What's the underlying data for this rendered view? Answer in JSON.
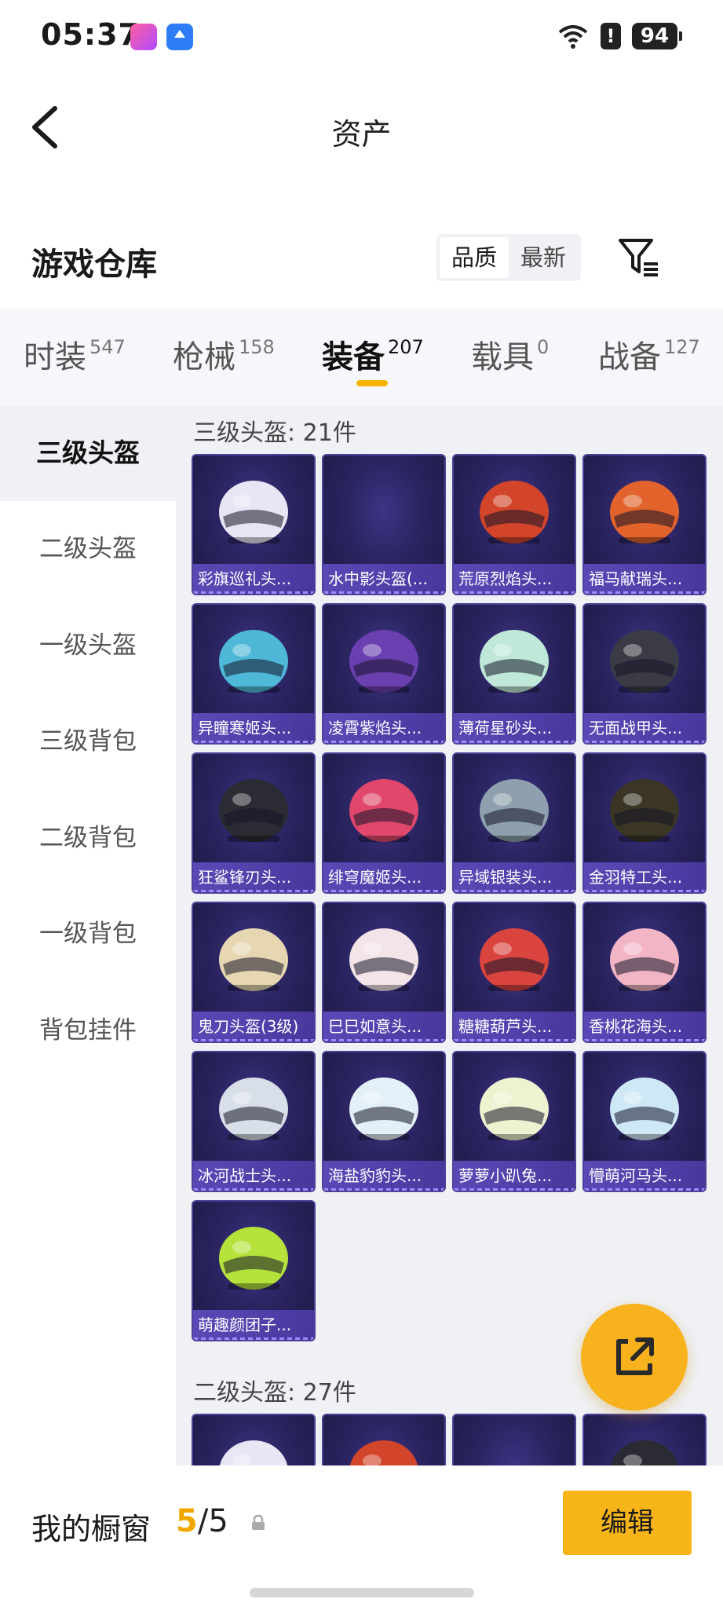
{
  "status_bar": {
    "time": "05:37",
    "battery": "94",
    "alert": "!"
  },
  "header": {
    "title": "资产"
  },
  "warehouse": {
    "title": "游戏仓库",
    "sort_options": [
      {
        "label": "品质",
        "active": true
      },
      {
        "label": "最新",
        "active": false
      }
    ]
  },
  "category_tabs": [
    {
      "label": "时装",
      "count": "547",
      "active": false
    },
    {
      "label": "枪械",
      "count": "158",
      "active": false
    },
    {
      "label": "装备",
      "count": "207",
      "active": true
    },
    {
      "label": "载具",
      "count": "0",
      "active": false
    },
    {
      "label": "战备",
      "count": "127",
      "active": false
    }
  ],
  "side_nav": [
    {
      "label": "三级头盔",
      "active": true
    },
    {
      "label": "二级头盔",
      "active": false
    },
    {
      "label": "一级头盔",
      "active": false
    },
    {
      "label": "三级背包",
      "active": false
    },
    {
      "label": "二级背包",
      "active": false
    },
    {
      "label": "一级背包",
      "active": false
    },
    {
      "label": "背包挂件",
      "active": false
    }
  ],
  "groups": [
    {
      "title": "三级头盔: 21件",
      "items": [
        {
          "name": "彩旗巡礼头...",
          "color": "#e8e6f4"
        },
        {
          "name": "水中影头盔(...",
          "color": ""
        },
        {
          "name": "荒原烈焰头...",
          "color": "#d2452a"
        },
        {
          "name": "福马献瑞头...",
          "color": "#e2632b"
        },
        {
          "name": "异瞳寒姬头...",
          "color": "#4fb8d8"
        },
        {
          "name": "凌霄紫焰头...",
          "color": "#6a3fb0"
        },
        {
          "name": "薄荷星砂头...",
          "color": "#bfe8d8"
        },
        {
          "name": "无面战甲头...",
          "color": "#3b3b46"
        },
        {
          "name": "狂鲨锋刃头...",
          "color": "#2b2b33"
        },
        {
          "name": "绯穹魔姬头...",
          "color": "#e0476b"
        },
        {
          "name": "异域银装头...",
          "color": "#8ea0ad"
        },
        {
          "name": "金羽特工头...",
          "color": "#3a3524"
        },
        {
          "name": "鬼刀头盔(3级)",
          "color": "#e6d7b2"
        },
        {
          "name": "巳巳如意头...",
          "color": "#f3e4e8"
        },
        {
          "name": "糖糖葫芦头...",
          "color": "#d9443e"
        },
        {
          "name": "香桃花海头...",
          "color": "#f2b5c6"
        },
        {
          "name": "冰河战士头...",
          "color": "#d8dfe8"
        },
        {
          "name": "海盐豹豹头...",
          "color": "#e4f0f8"
        },
        {
          "name": "萝萝小趴兔...",
          "color": "#eef2d0"
        },
        {
          "name": "懵萌河马头...",
          "color": "#cfe8f6"
        },
        {
          "name": "萌趣颜团子...",
          "color": "#b6e23c"
        }
      ]
    },
    {
      "title": "二级头盔: 27件",
      "items": [
        {
          "name": "",
          "color": "#e8e6f4"
        },
        {
          "name": "",
          "color": "#d2452a"
        },
        {
          "name": "",
          "color": ""
        },
        {
          "name": "",
          "color": "#2b2b33"
        }
      ]
    }
  ],
  "showcase": {
    "label": "我的橱窗",
    "used": "5",
    "separator": "/",
    "total": "5"
  },
  "edit_button": "编辑"
}
